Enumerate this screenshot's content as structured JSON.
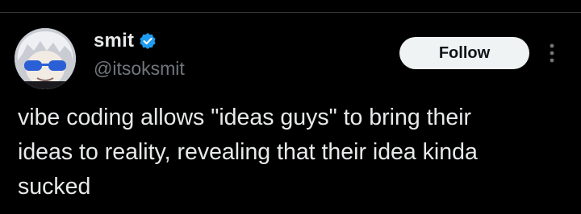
{
  "author": {
    "display_name": "smit",
    "handle": "@itsoksmit",
    "verified_icon": "verified-badge-icon",
    "avatar_icon": "avatar-anime-character"
  },
  "actions": {
    "follow_label": "Follow",
    "more_icon": "vertical-ellipsis-icon"
  },
  "tweet": {
    "lines": [
      "vibe coding allows \"ideas guys\" to bring their",
      "ideas to reality, revealing that their idea kinda",
      "sucked"
    ]
  },
  "colors": {
    "background": "#000000",
    "text_primary": "#e7e9ea",
    "text_secondary": "#71767b",
    "verified_blue": "#1d9bf0",
    "follow_bg": "#eff3f4"
  }
}
